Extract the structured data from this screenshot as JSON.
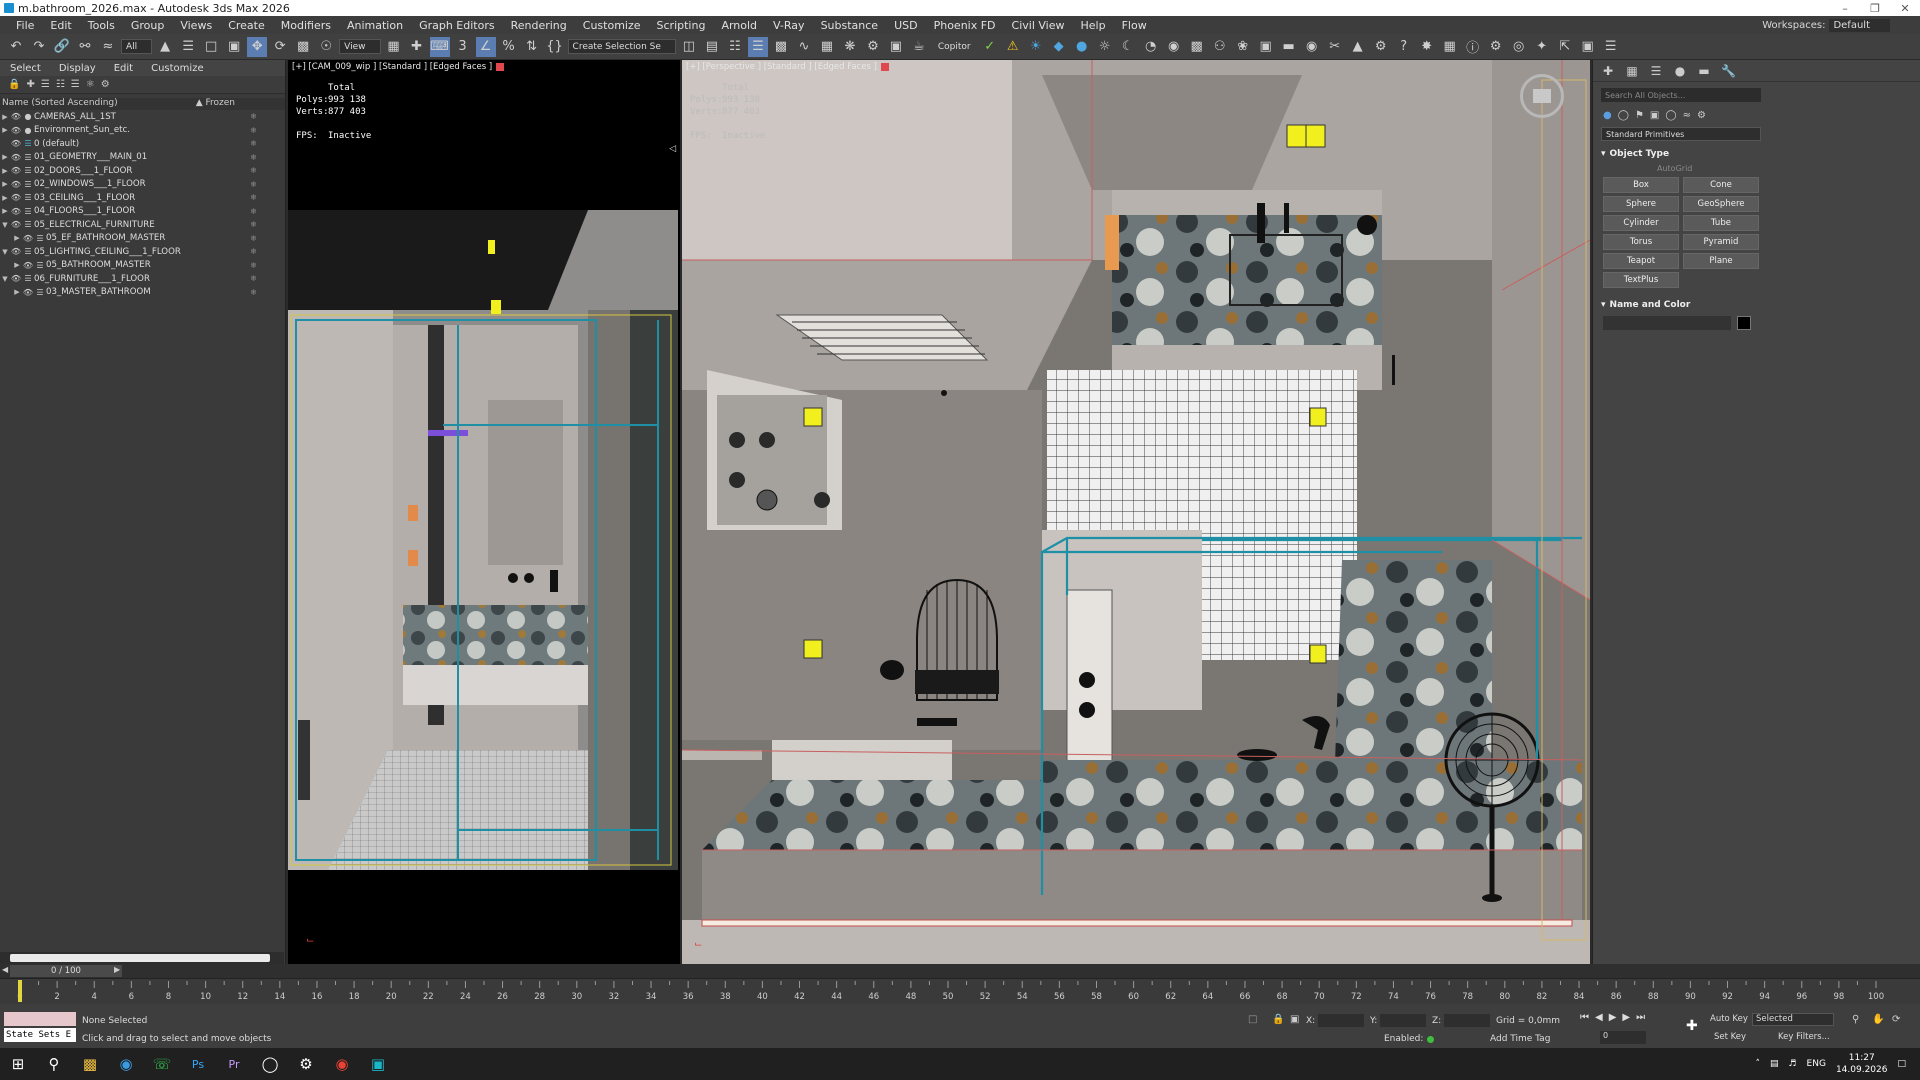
{
  "window": {
    "title": "m.bathroom_2026.max - Autodesk 3ds Max 2026"
  },
  "menu": [
    "File",
    "Edit",
    "Tools",
    "Group",
    "Views",
    "Create",
    "Modifiers",
    "Animation",
    "Graph Editors",
    "Rendering",
    "Customize",
    "Scripting",
    "Arnold",
    "V-Ray",
    "Substance",
    "USD",
    "Phoenix FD",
    "Civil View",
    "Help",
    "Flow"
  ],
  "workspaces": {
    "label": "Workspaces:",
    "value": "Default"
  },
  "toolbar": {
    "filter_value": "All",
    "ref_coord": "View",
    "selection_set": "Create Selection Se",
    "copitor": "Copitor"
  },
  "explorer": {
    "tabs": [
      "Select",
      "Display",
      "Edit",
      "Customize"
    ],
    "sort_header": "Name (Sorted Ascending)",
    "frozen_header": "▲ Frozen",
    "items": [
      {
        "label": "CAMERAS_ALL_1ST",
        "indent": 0,
        "expanded": false
      },
      {
        "label": "Environment_Sun_etc.",
        "indent": 0,
        "expanded": false
      },
      {
        "label": "0 (default)",
        "indent": 0,
        "expanded": false
      },
      {
        "label": "01_GEOMETRY___MAIN_01",
        "indent": 0,
        "expanded": false
      },
      {
        "label": "02_DOORS___1_FLOOR",
        "indent": 0,
        "expanded": false
      },
      {
        "label": "02_WINDOWS___1_FLOOR",
        "indent": 0,
        "expanded": false
      },
      {
        "label": "03_CEILING___1_FLOOR",
        "indent": 0,
        "expanded": false
      },
      {
        "label": "04_FLOORS___1_FLOOR",
        "indent": 0,
        "expanded": false
      },
      {
        "label": "05_ELECTRICAL_FURNITURE",
        "indent": 0,
        "expanded": true
      },
      {
        "label": "05_EF_BATHROOM_MASTER",
        "indent": 1,
        "expanded": false
      },
      {
        "label": "05_LIGHTING_CEILING___1_FLOOR",
        "indent": 0,
        "expanded": true
      },
      {
        "label": "05_BATHROOM_MASTER",
        "indent": 1,
        "expanded": false
      },
      {
        "label": "06_FURNITURE___1_FLOOR",
        "indent": 0,
        "expanded": true
      },
      {
        "label": "03_MASTER_BATHROOM",
        "indent": 1,
        "expanded": false
      }
    ]
  },
  "viewport_left": {
    "label": "[+] [CAM_009_wip ] [Standard ] [Edged Faces ]",
    "stats": {
      "total": "Total",
      "polys_label": "Polys:",
      "polys": "993 138",
      "verts_label": "Verts:",
      "verts": "877 403",
      "fps_label": "FPS:",
      "fps": "Inactive"
    }
  },
  "viewport_right": {
    "label": "[+] [Perspective ] [Standard ] [Edged Faces ]",
    "stats": {
      "total": "Total",
      "polys_label": "Polys:",
      "polys": "993 138",
      "verts_label": "Verts:",
      "verts": "877 403",
      "fps_label": "FPS:",
      "fps": "Inactive"
    }
  },
  "command_panel": {
    "search_placeholder": "Search All Objects...",
    "category": "Standard Primitives",
    "object_type_title": "Object Type",
    "autogrid": "AutoGrid",
    "buttons": [
      "Box",
      "Cone",
      "Sphere",
      "GeoSphere",
      "Cylinder",
      "Tube",
      "Torus",
      "Pyramid",
      "Teapot",
      "Plane",
      "TextPlus"
    ],
    "name_color_title": "Name and Color"
  },
  "timeline": {
    "slider_label": "0 / 100",
    "ticks": [
      0,
      2,
      4,
      6,
      8,
      10,
      12,
      14,
      16,
      18,
      20,
      22,
      24,
      26,
      28,
      30,
      32,
      34,
      36,
      38,
      40,
      42,
      44,
      46,
      48,
      50,
      52,
      54,
      56,
      58,
      60,
      62,
      64,
      66,
      68,
      70,
      72,
      74,
      76,
      78,
      80,
      82,
      84,
      86,
      88,
      90,
      92,
      94,
      96,
      98,
      100
    ]
  },
  "status": {
    "state_sets": "State Sets E",
    "selection": "None Selected",
    "prompt": "Click and drag to select and move objects",
    "x_label": "X:",
    "y_label": "Y:",
    "z_label": "Z:",
    "grid": "Grid = 0,0mm",
    "enabled": "Enabled:",
    "add_time_tag": "Add Time Tag",
    "auto_key": "Auto Key",
    "set_key": "Set Key",
    "selected_dropdown": "Selected",
    "key_filters": "Key Filters...",
    "frame_value": "0"
  },
  "taskbar": {
    "lang": "ENG",
    "time": "11:27",
    "date": "14.09.2026"
  },
  "colors": {
    "accent": "#5b7db1",
    "highlight_yellow": "#f2ef1e",
    "selection_cyan": "#1f8fa6"
  }
}
